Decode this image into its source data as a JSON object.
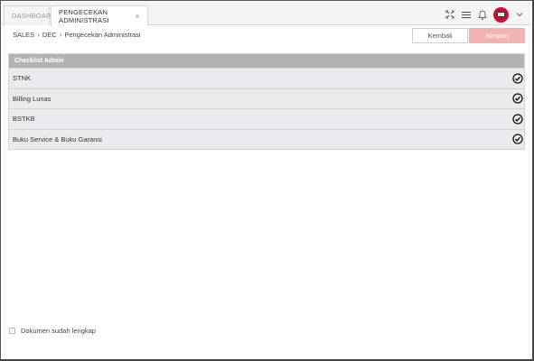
{
  "tabs": [
    {
      "label": "DASHBOARD"
    },
    {
      "label": "PENGECEKAN ADMINISTRASI",
      "close": "×"
    }
  ],
  "breadcrumb": [
    "SALES",
    "DEC",
    "Pengecekan Administrasi"
  ],
  "actions": {
    "back_label": "Kembali",
    "save_label": "Simpan"
  },
  "checklist": {
    "title": "Checklist Admin",
    "items": [
      {
        "label": "STNK"
      },
      {
        "label": "Billing Lunas"
      },
      {
        "label": "BSTKB"
      },
      {
        "label": "Buku Service & Buku Garansi"
      }
    ]
  },
  "footer": {
    "complete_label": "Dokumen sudah lengkap"
  },
  "colors": {
    "accent": "#c8102e",
    "save_button": "#f4b3b3",
    "header": "#b3b3b3",
    "row": "#ebebef"
  },
  "icons": [
    "fullscreen-icon",
    "menu-icon",
    "bell-icon",
    "avatar-icon",
    "chevron-down-icon",
    "check-circle-icon",
    "close-icon"
  ]
}
